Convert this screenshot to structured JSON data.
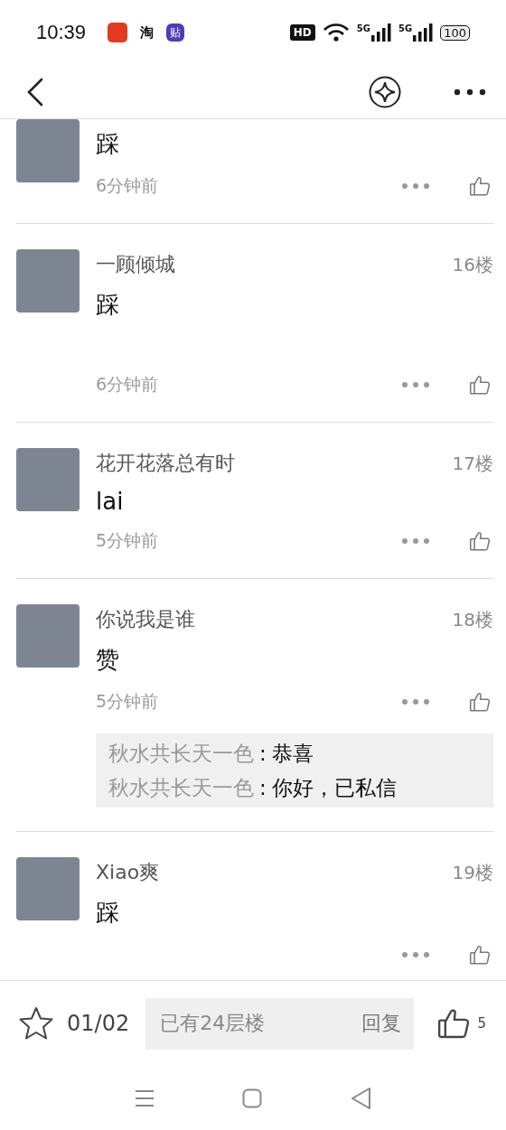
{
  "status_bar": {
    "time": "10:39",
    "notifications": [
      {
        "kind": "app"
      },
      {
        "kind": "glyph",
        "text": "淘"
      },
      {
        "kind": "badge",
        "text": "贴"
      }
    ],
    "hd": "HD",
    "networks": [
      "5G",
      "5G"
    ],
    "battery": "100"
  },
  "posts": [
    {
      "content": "踩",
      "time": "6分钟前"
    },
    {
      "name": "一顾倾城",
      "floor": "16楼",
      "content": "踩",
      "time": "6分钟前",
      "tall": true
    },
    {
      "name": "花开花落总有时",
      "floor": "17楼",
      "content": "lai",
      "time": "5分钟前"
    },
    {
      "name": "你说我是谁",
      "floor": "18楼",
      "content": "赞",
      "time": "5分钟前",
      "replies": [
        {
          "author": "秋水共长天一色",
          "separator": ":",
          "text": "恭喜"
        },
        {
          "author": "秋水共长天一色",
          "separator": ":",
          "text": "你好，已私信"
        }
      ]
    },
    {
      "name": "Xiao爽",
      "floor": "19楼",
      "content": "踩"
    }
  ],
  "bottom_bar": {
    "page": "01/02",
    "reply_placeholder": "已有24层楼",
    "reply_button": "回复",
    "like_count": "5"
  }
}
